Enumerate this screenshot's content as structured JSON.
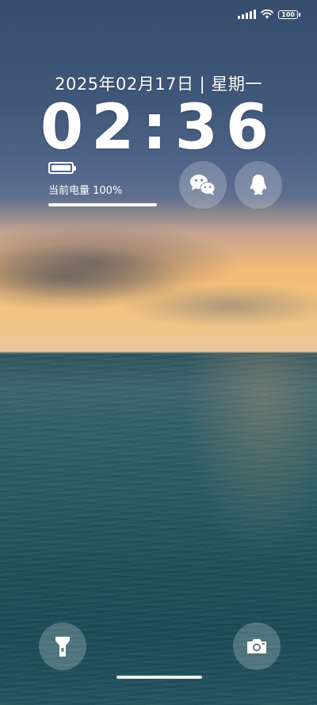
{
  "status_bar": {
    "battery_level": "100",
    "icons": [
      "signal-icon",
      "wifi-icon",
      "battery-icon"
    ]
  },
  "lock_screen": {
    "date": "2025年02月17日 | 星期一",
    "time": "02:36"
  },
  "battery_widget": {
    "label": "当前电量 100%",
    "level_percent": 100
  },
  "shortcuts": {
    "apps": [
      "wechat-icon",
      "qq-icon"
    ],
    "bottom_left": "flashlight-icon",
    "bottom_right": "camera-icon"
  },
  "colors": {
    "sky_top": "#364d6e",
    "sunset": "#f4c27d",
    "sea": "#1d4e59"
  }
}
